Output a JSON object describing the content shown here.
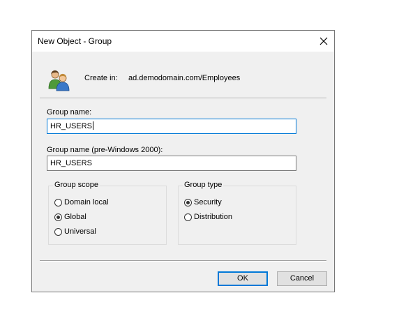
{
  "dialog": {
    "title": "New Object - Group",
    "close_icon": "close-icon"
  },
  "header": {
    "icon": "users-icon",
    "create_in_label": "Create in:",
    "create_in_value": "ad.demodomain.com/Employees"
  },
  "fields": {
    "group_name_label": "Group name:",
    "group_name_value": "HR_USERS",
    "pre2000_label": "Group name (pre-Windows 2000):",
    "pre2000_value": "HR_USERS"
  },
  "group_scope": {
    "title": "Group scope",
    "options": [
      {
        "label": "Domain local",
        "checked": false
      },
      {
        "label": "Global",
        "checked": true
      },
      {
        "label": "Universal",
        "checked": false
      }
    ]
  },
  "group_type": {
    "title": "Group type",
    "options": [
      {
        "label": "Security",
        "checked": true
      },
      {
        "label": "Distribution",
        "checked": false
      }
    ]
  },
  "buttons": {
    "ok_label": "OK",
    "cancel_label": "Cancel"
  },
  "colors": {
    "focus_accent": "#0078d7",
    "dialog_bg": "#f0f0f0"
  }
}
